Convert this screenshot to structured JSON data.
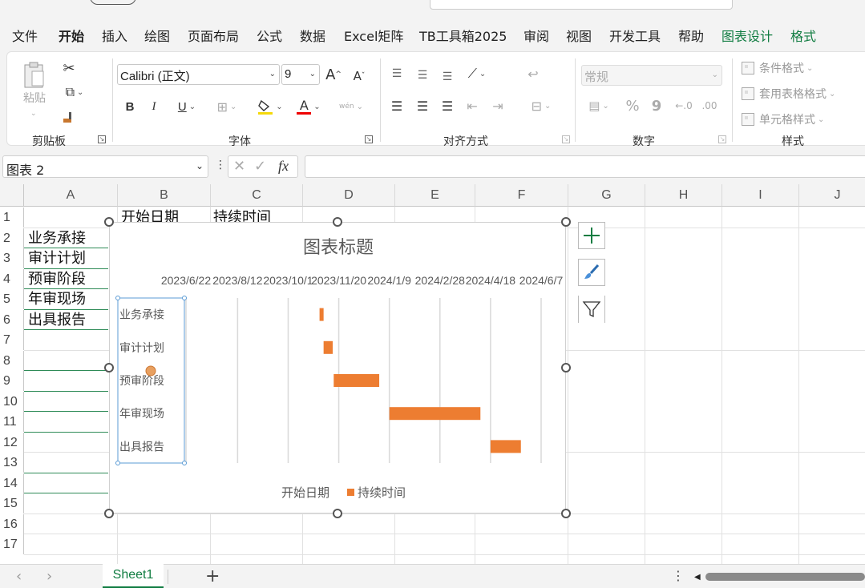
{
  "menu": {
    "tabs": [
      "文件",
      "开始",
      "插入",
      "绘图",
      "页面布局",
      "公式",
      "数据",
      "Excel矩阵",
      "TB工具箱2025",
      "审阅",
      "视图",
      "开发工具",
      "帮助",
      "图表设计",
      "格式"
    ],
    "active": "开始"
  },
  "ribbon": {
    "clipboard": {
      "paste": "粘贴",
      "label": "剪贴板"
    },
    "font": {
      "name": "Calibri (正文)",
      "size": "9",
      "bold": "B",
      "italic": "I",
      "underline": "U",
      "grow": "A",
      "shrink": "A",
      "color_glyph": "A",
      "label": "字体",
      "wen": "wén"
    },
    "alignment": {
      "label": "对齐方式"
    },
    "number": {
      "format": "常规",
      "percent": "%",
      "comma": "9",
      "label": "数字"
    },
    "styles": {
      "conditional": "条件格式",
      "table": "套用表格格式",
      "cell": "单元格样式",
      "label": "样式"
    }
  },
  "formula_bar": {
    "name_box": "图表 2",
    "fx": "fx",
    "formula": ""
  },
  "columns": [
    "A",
    "B",
    "C",
    "D",
    "E",
    "F",
    "G",
    "H",
    "I",
    "J"
  ],
  "rows": [
    "1",
    "2",
    "3",
    "4",
    "5",
    "6",
    "7",
    "8",
    "9",
    "10",
    "11",
    "12",
    "13",
    "14",
    "15",
    "16",
    "17"
  ],
  "cells": {
    "B1": "开始日期",
    "C1": "持续时间",
    "A2": "业务承接",
    "A3": "审计计划",
    "A4": "预审阶段",
    "A5": "年审现场",
    "A6": "出具报告"
  },
  "chart_data": {
    "type": "bar",
    "orientation": "horizontal-stacked",
    "title": "图表标题",
    "categories": [
      "业务承接",
      "审计计划",
      "预审阶段",
      "年审现场",
      "出具报告"
    ],
    "x_tick_labels": [
      "2023/6/22",
      "2023/8/12",
      "2023/10/1",
      "2023/11/20",
      "2024/1/9",
      "2024/2/28",
      "2024/4/18",
      "2024/6/7"
    ],
    "x_axis": "top",
    "x_range": [
      "2023/6/22",
      "2024/6/7"
    ],
    "series": [
      {
        "name": "开始日期",
        "color": "none",
        "values": [
          "2023/11/1",
          "2023/11/5",
          "2023/11/15",
          "2024/1/9",
          "2024/4/18"
        ]
      },
      {
        "name": "持续时间",
        "color": "#ED7D31",
        "values": [
          4,
          9,
          45,
          90,
          30
        ]
      }
    ],
    "legend": [
      "开始日期",
      "持续时间"
    ],
    "legend_position": "bottom",
    "grid": "vertical"
  },
  "sheets": {
    "tabs": [
      "Sheet1"
    ],
    "active": "Sheet1"
  },
  "colors": {
    "accent": "#107C41",
    "bar": "#ED7D31"
  }
}
